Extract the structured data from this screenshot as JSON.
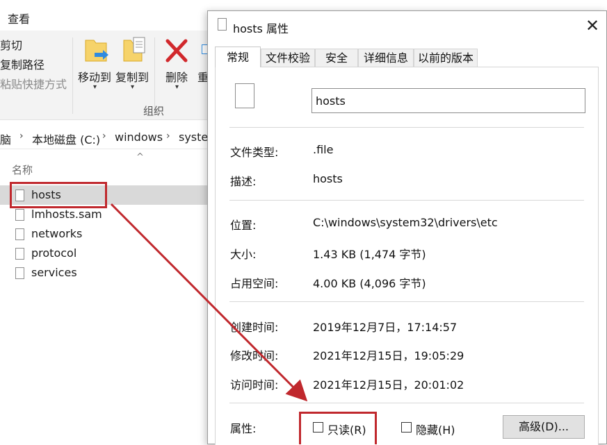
{
  "explorer": {
    "view_tab": "查看",
    "ribbon": {
      "cut": "剪切",
      "copy_path": "复制路径",
      "paste_shortcut": "粘贴快捷方式",
      "move_to": "移动到",
      "copy_to": "复制到",
      "delete": "删除",
      "rename_partial": "重",
      "group_label": "组织"
    },
    "breadcrumb": [
      "脑",
      "本地磁盘 (C:)",
      "windows",
      "syster"
    ],
    "column_name": "名称",
    "files": [
      "hosts",
      "lmhosts.sam",
      "networks",
      "protocol",
      "services"
    ]
  },
  "dialog": {
    "title": "hosts 属性",
    "tabs": [
      "常规",
      "文件校验",
      "安全",
      "详细信息",
      "以前的版本"
    ],
    "file_name_value": "hosts",
    "rows": {
      "type": {
        "label": "文件类型:",
        "value": ".file"
      },
      "desc": {
        "label": "描述:",
        "value": "hosts"
      },
      "location": {
        "label": "位置:",
        "value": "C:\\windows\\system32\\drivers\\etc"
      },
      "size": {
        "label": "大小:",
        "value": "1.43 KB (1,474 字节)"
      },
      "disk": {
        "label": "占用空间:",
        "value": "4.00 KB (4,096 字节)"
      },
      "created": {
        "label": "创建时间:",
        "value": "2019年12月7日，17:14:57"
      },
      "modified": {
        "label": "修改时间:",
        "value": "2021年12月15日，19:05:29"
      },
      "accessed": {
        "label": "访问时间:",
        "value": "2021年12月15日，20:01:02"
      }
    },
    "attributes_label": "属性:",
    "readonly_label": "只读(R)",
    "hidden_label": "隐藏(H)",
    "advanced_button": "高级(D)..."
  },
  "colors": {
    "annotation_red": "#c0282d",
    "selection_gray": "#d9d9d9"
  }
}
